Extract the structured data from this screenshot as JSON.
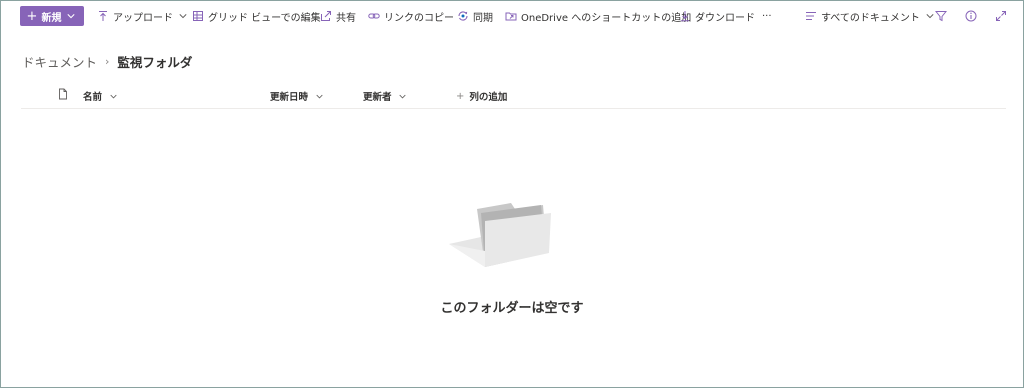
{
  "command_bar": {
    "new_label": "新規",
    "upload_label": "アップロード",
    "grid_edit_label": "グリッド ビューでの編集",
    "share_label": "共有",
    "copy_link_label": "リンクのコピー",
    "sync_label": "同期",
    "onedrive_shortcut_label": "OneDrive へのショートカットの追加",
    "download_label": "ダウンロード",
    "more_label": "···",
    "view_label": "すべてのドキュメント"
  },
  "breadcrumb": {
    "root": "ドキュメント",
    "separator": "›",
    "current": "監視フォルダ"
  },
  "columns": {
    "name": "名前",
    "modified": "更新日時",
    "modified_by": "更新者",
    "add_column": "列の追加",
    "add_plus": "+"
  },
  "empty_state": {
    "message": "このフォルダーは空です"
  },
  "colors": {
    "accent": "#8764b8",
    "icon_purple": "#8764b8",
    "text": "#323130",
    "muted": "#605e5c"
  },
  "icons": {
    "upload": "upload-icon",
    "grid": "grid-icon",
    "share": "share-icon",
    "link": "link-icon",
    "sync": "sync-icon",
    "onedrive": "onedrive-shortcut-icon",
    "download": "download-icon",
    "view": "view-list-icon",
    "filter": "filter-icon",
    "info": "info-icon",
    "expand": "expand-icon",
    "file_type": "document-icon"
  }
}
